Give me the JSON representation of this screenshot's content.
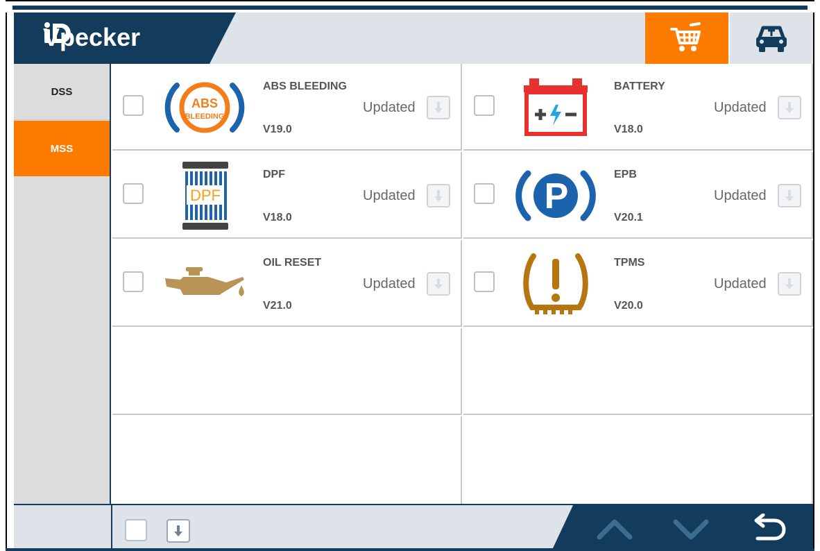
{
  "app": {
    "brand": "Vpecker",
    "accent": "#ff7b00",
    "navy": "#133b5c"
  },
  "header": {
    "cart_icon": "shopping-cart-icon",
    "car_icon": "car-service-icon"
  },
  "sidebar": {
    "items": [
      {
        "label": "DSS",
        "active": false
      },
      {
        "label": "MSS",
        "active": true
      }
    ]
  },
  "functions": [
    {
      "name": "ABS BLEEDING",
      "version": "V19.0",
      "status": "Updated",
      "icon": "abs-bleeding-icon"
    },
    {
      "name": "BATTERY",
      "version": "V18.0",
      "status": "Updated",
      "icon": "battery-icon"
    },
    {
      "name": "DPF",
      "version": "V18.0",
      "status": "Updated",
      "icon": "dpf-filter-icon"
    },
    {
      "name": "EPB",
      "version": "V20.1",
      "status": "Updated",
      "icon": "parking-brake-icon"
    },
    {
      "name": "OIL RESET",
      "version": "V21.0",
      "status": "Updated",
      "icon": "oil-can-icon"
    },
    {
      "name": "TPMS",
      "version": "V20.0",
      "status": "Updated",
      "icon": "tire-pressure-icon"
    }
  ],
  "icon_labels": {
    "abs_top": "ABS",
    "abs_bottom": "BLEEDING",
    "dpf": "DPF",
    "epb": "P"
  },
  "footer": {
    "up_icon": "chevron-up-icon",
    "down_icon": "chevron-down-icon",
    "back_icon": "return-icon"
  }
}
